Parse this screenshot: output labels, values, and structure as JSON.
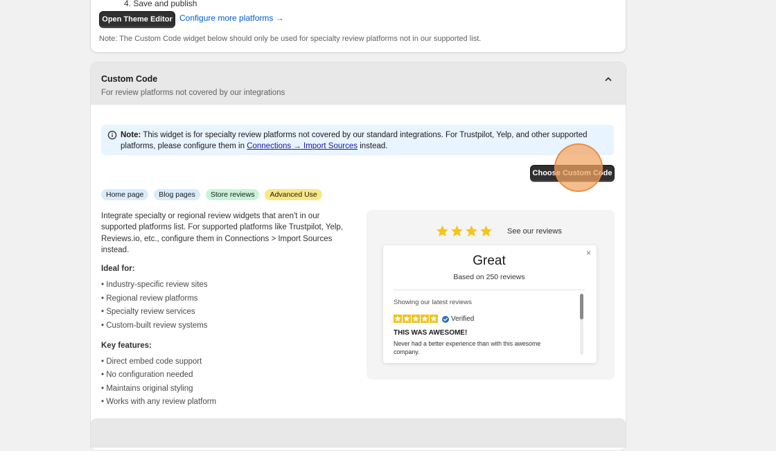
{
  "top_section": {
    "previous_step": "4. Save and publish",
    "theme_editor_button": "Open Theme Editor",
    "configure_link": "Configure more platforms →",
    "note": "Note: The Custom Code widget below should only be used for specialty review platforms not in our supported list."
  },
  "custom_code": {
    "title": "Custom Code",
    "subtitle": "For review platforms not covered by our integrations",
    "banner": {
      "label": "Note:",
      "text_before": "This widget is for specialty review platforms not covered by our standard integrations. For Trustpilot, Yelp, and other supported platforms, please configure them in",
      "link": "Connections → Import Sources",
      "text_after": "instead."
    },
    "choose_button": "Choose Custom Code",
    "tags": [
      "Home page",
      "Blog pages",
      "Store reviews",
      "Advanced Use"
    ],
    "description": "Integrate specialty or regional review widgets that aren't in our supported platforms list. For supported platforms like Trustpilot, Yelp, Reviews.io, etc., configure them in Connections > Import Sources instead.",
    "ideal_for_heading": "Ideal for:",
    "ideal_for": [
      "• Industry-specific review sites",
      "• Regional review platforms",
      "• Specialty review services",
      "• Custom-built review systems"
    ],
    "key_features_heading": "Key features:",
    "key_features": [
      "• Direct embed code support",
      "• No configuration needed",
      "• Maintains original styling",
      "• Works with any review platform"
    ]
  },
  "preview": {
    "see_reviews": "See our reviews",
    "rating_word": "Great",
    "based_on": "Based on 250 reviews",
    "showing": "Showing our latest reviews",
    "verified": "Verified",
    "review_title": "THIS WAS AWESOME!",
    "review_body": "Never had a better experience than with this awesome company.",
    "close_glyph": "×",
    "star_color": "#f5c518",
    "small_star_color": "#f0c419"
  },
  "colors": {
    "accent_link": "#005bd3",
    "button_dark": "#303030",
    "banner_bg": "#e8f4ff",
    "cursor_highlight": "#f3a360"
  }
}
